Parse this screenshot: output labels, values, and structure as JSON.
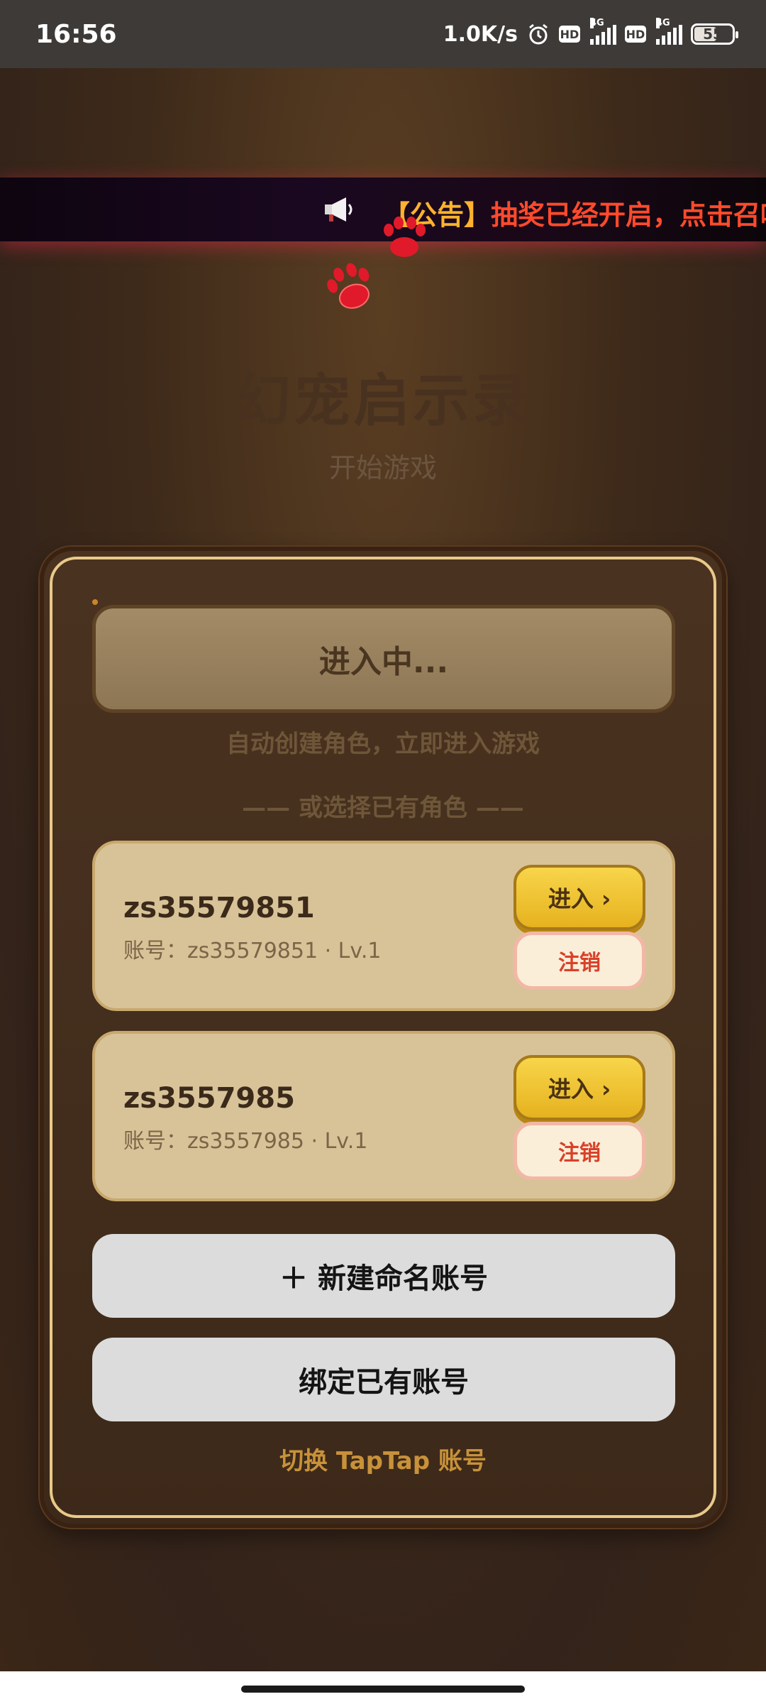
{
  "status_bar": {
    "time": "16:56",
    "net_speed": "1.0K/s",
    "hd_label": "HD",
    "network_type": "4G",
    "battery": "55"
  },
  "announcement": {
    "tag": "【公告】",
    "text": "抽奖已经开启，点击召唤"
  },
  "header": {
    "title": "幻宠启示录",
    "subtitle": "开始游戏"
  },
  "panel": {
    "entering_label": "进入中...",
    "auto_create_hint": "自动创建角色，立即进入游戏",
    "divider_text": "—— 或选择已有角色 ——",
    "roles": [
      {
        "name": "zs35579851",
        "meta": "账号：zs35579851 · Lv.1",
        "enter_label": "进入 ›",
        "cancel_label": "注销"
      },
      {
        "name": "zs3557985",
        "meta": "账号：zs3557985 · Lv.1",
        "enter_label": "进入 ›",
        "cancel_label": "注销"
      }
    ],
    "new_account_label": "＋ 新建命名账号",
    "bind_account_label": "绑定已有账号",
    "switch_label": "切换 TapTap 账号"
  },
  "colors": {
    "accent_gold": "#e6b21f",
    "announce_red": "#ff4a2c",
    "announce_tag": "#ffb22c",
    "cancel_red": "#d8412a",
    "paw_red": "#e01a2a"
  },
  "icons": {
    "announce": "megaphone-icon",
    "decor": "paw-icon",
    "alarm": "alarm-icon",
    "battery": "battery-icon"
  }
}
